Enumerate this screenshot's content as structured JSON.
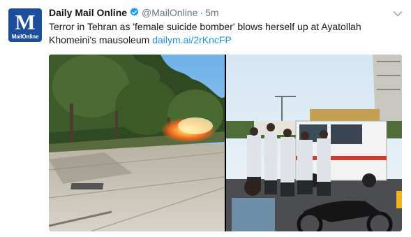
{
  "tweet": {
    "author_name": "Daily Mail Online",
    "handle": "@MailOnline",
    "separator": "·",
    "time": "5m",
    "text": "Terror in Tehran as 'female suicide bomber' blows herself up at Ayatollah Khomeini's mausoleum ",
    "link_text": "dailym.ai/2rKncFP",
    "avatar": {
      "letter": "M",
      "brand": "MailOnline",
      "color": "#1d4e9e"
    },
    "icons": {
      "verified": "verified-badge-icon",
      "menu": "chevron-down-icon"
    },
    "colors": {
      "link": "#1b95e0",
      "muted": "#657786",
      "verified": "#1da1f2"
    }
  }
}
